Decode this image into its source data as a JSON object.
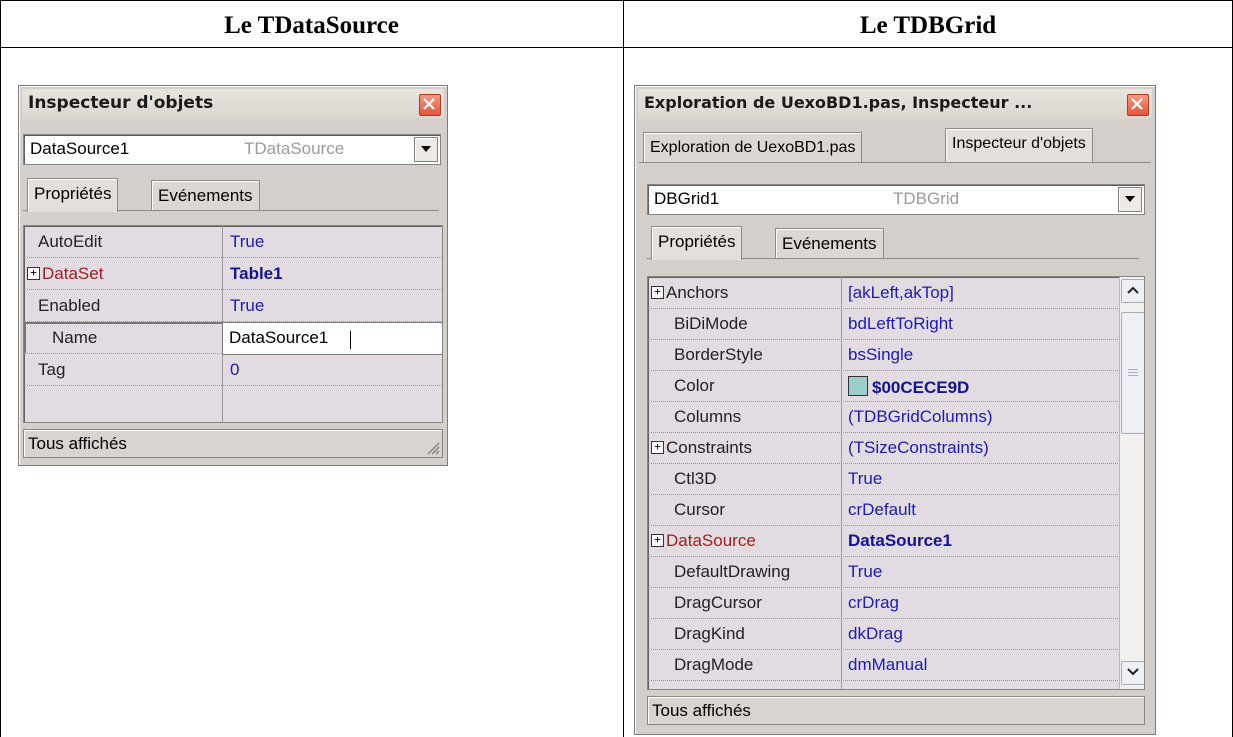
{
  "headers": {
    "left": "Le TDataSource",
    "right": "Le TDBGrid"
  },
  "datasource_panel": {
    "title": "Inspecteur d'objets",
    "object_name": "DataSource1",
    "object_type": "TDataSource",
    "tabs": [
      "Propriétés",
      "Evénements"
    ],
    "properties": [
      {
        "name": "AutoEdit",
        "value": "True"
      },
      {
        "name": "DataSet",
        "value": "Table1"
      },
      {
        "name": "Enabled",
        "value": "True"
      },
      {
        "name": "Name",
        "value": "DataSource1"
      },
      {
        "name": "Tag",
        "value": "0"
      }
    ],
    "status": "Tous affichés"
  },
  "dbgrid_panel": {
    "title": "Exploration de UexoBD1.pas, Inspecteur ...",
    "outer_tabs": [
      "Exploration de UexoBD1.pas",
      "Inspecteur d'objets"
    ],
    "object_name": "DBGrid1",
    "object_type": "TDBGrid",
    "tabs": [
      "Propriétés",
      "Evénements"
    ],
    "properties": [
      {
        "name": "Anchors",
        "value": "[akLeft,akTop]"
      },
      {
        "name": "BiDiMode",
        "value": "bdLeftToRight"
      },
      {
        "name": "BorderStyle",
        "value": "bsSingle"
      },
      {
        "name": "Color",
        "value": "$00CECE9D"
      },
      {
        "name": "Columns",
        "value": "(TDBGridColumns)"
      },
      {
        "name": "Constraints",
        "value": "(TSizeConstraints)"
      },
      {
        "name": "Ctl3D",
        "value": "True"
      },
      {
        "name": "Cursor",
        "value": "crDefault"
      },
      {
        "name": "DataSource",
        "value": "DataSource1"
      },
      {
        "name": "DefaultDrawing",
        "value": "True"
      },
      {
        "name": "DragCursor",
        "value": "crDrag"
      },
      {
        "name": "DragKind",
        "value": "dkDrag"
      },
      {
        "name": "DragMode",
        "value": "dmManual"
      }
    ],
    "status": "Tous affichés"
  },
  "colors": {
    "window_bg": "#d4cfca",
    "grid_bg": "#e2dbe2",
    "value_text": "#1c1cb0",
    "reference_prop": "#a0201c",
    "close_button": "#e4553b",
    "color_swatch": "#9dcece"
  },
  "icons": {
    "close": "close-icon",
    "dropdown": "chevron-down-icon",
    "expand": "plus-box-icon",
    "scroll_up": "chevron-up-icon",
    "scroll_down": "chevron-down-icon",
    "resize": "resize-grip-icon"
  }
}
